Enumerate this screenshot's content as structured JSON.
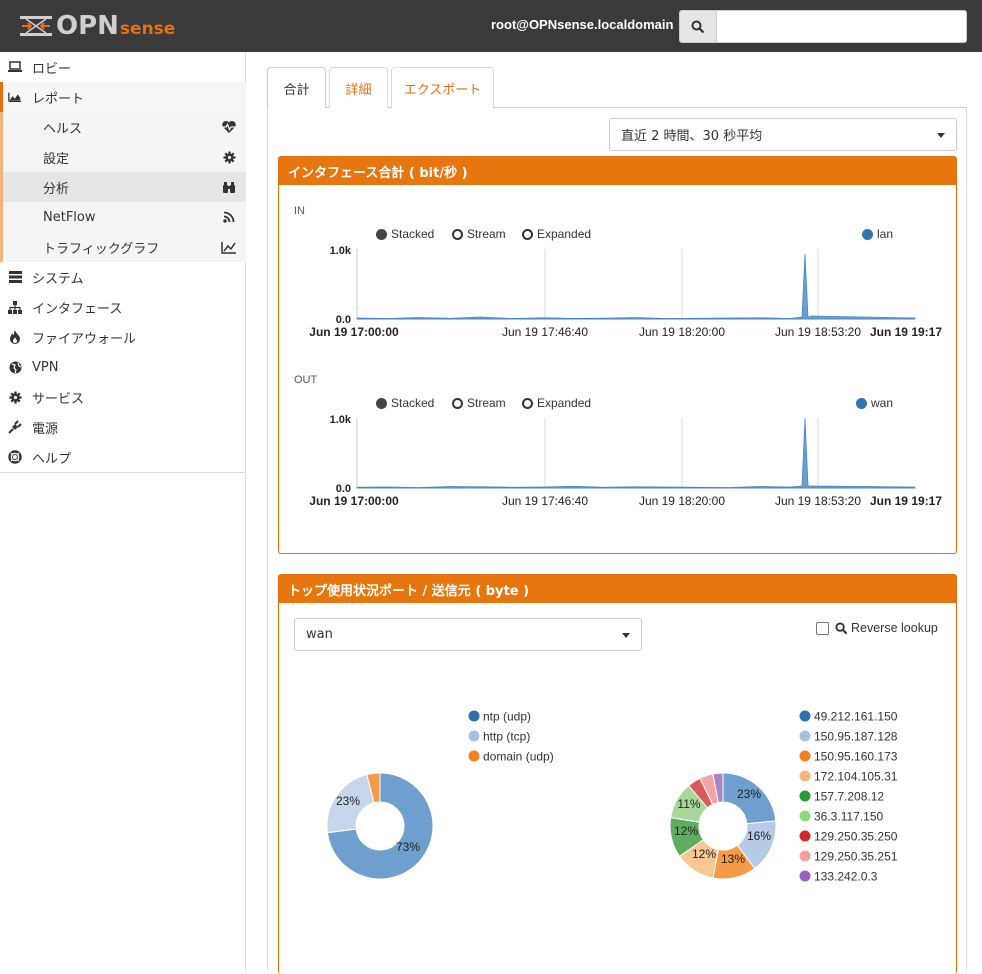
{
  "topbar": {
    "logo_opn": "OPN",
    "logo_sense": "sense",
    "user": "root@OPNsense.localdomain",
    "search_placeholder": ""
  },
  "sidebar": {
    "items": [
      {
        "label": "ロビー",
        "icon": "laptop-icon"
      },
      {
        "label": "レポート",
        "icon": "area-chart-icon"
      },
      {
        "label": "ヘルス",
        "icon": "heartbeat-icon",
        "sub": true
      },
      {
        "label": "設定",
        "icon": "gear-icon",
        "sub": true
      },
      {
        "label": "分析",
        "icon": "binoculars-icon",
        "sub": true,
        "selected": true
      },
      {
        "label": "NetFlow",
        "icon": "rss-icon",
        "sub": true
      },
      {
        "label": "トラフィックグラフ",
        "icon": "line-chart-icon",
        "sub": true
      },
      {
        "label": "システム",
        "icon": "server-icon"
      },
      {
        "label": "インタフェース",
        "icon": "sitemap-icon"
      },
      {
        "label": "ファイアウォール",
        "icon": "fire-icon"
      },
      {
        "label": "VPN",
        "icon": "globe-icon"
      },
      {
        "label": "サービス",
        "icon": "cog-icon"
      },
      {
        "label": "電源",
        "icon": "plug-icon"
      },
      {
        "label": "ヘルプ",
        "icon": "life-ring-icon"
      }
    ]
  },
  "tabs": [
    {
      "label": "合計",
      "active": true
    },
    {
      "label": "詳細",
      "active": false
    },
    {
      "label": "エクスポート",
      "active": false
    }
  ],
  "range_select": "直近 2 時間、30 秒平均",
  "interface_panel": {
    "title": "インタフェース合計 ( bit/秒 )",
    "in": {
      "label": "IN",
      "modes": [
        "Stacked",
        "Stream",
        "Expanded"
      ],
      "series": "lan"
    },
    "out": {
      "label": "OUT",
      "modes": [
        "Stacked",
        "Stream",
        "Expanded"
      ],
      "series": "wan"
    },
    "y_ticks": [
      "1.0k",
      "0.0"
    ],
    "x_ticks": [
      "Jun 19 17:00:00",
      "Jun 19 17:46:40",
      "Jun 19 18:20:00",
      "Jun 19 18:53:20",
      "Jun 19 19:17"
    ]
  },
  "chart_data": [
    {
      "type": "area",
      "title": "",
      "xlabel": "",
      "ylabel": "",
      "series": [
        {
          "name": "lan",
          "values": [
            20,
            10,
            30,
            15,
            40,
            10,
            25,
            12,
            18,
            30,
            10,
            15,
            20,
            25,
            10,
            1300,
            60,
            20
          ]
        }
      ],
      "x": [
        "17:00",
        "17:07",
        "17:14",
        "17:21",
        "17:28",
        "17:35",
        "17:42",
        "17:49",
        "17:56",
        "18:03",
        "18:10",
        "18:17",
        "18:24",
        "18:31",
        "18:38",
        "18:45",
        "18:52",
        "18:59"
      ],
      "ylim": [
        0,
        1400
      ]
    },
    {
      "type": "area",
      "title": "",
      "xlabel": "",
      "ylabel": "",
      "series": [
        {
          "name": "wan",
          "values": [
            15,
            20,
            10,
            30,
            25,
            15,
            20,
            35,
            15,
            25,
            20,
            15,
            10,
            30,
            20,
            1400,
            40,
            20
          ]
        }
      ],
      "x": [
        "17:00",
        "17:07",
        "17:14",
        "17:21",
        "17:28",
        "17:35",
        "17:42",
        "17:49",
        "17:56",
        "18:03",
        "18:10",
        "18:17",
        "18:24",
        "18:31",
        "18:38",
        "18:45",
        "18:52",
        "18:59"
      ],
      "ylim": [
        0,
        1400
      ]
    },
    {
      "type": "pie",
      "series": [
        {
          "name": "",
          "values": [
            73,
            23,
            4
          ]
        }
      ],
      "categories": [
        "ntp (udp)",
        "http (tcp)",
        "domain (udp)"
      ],
      "colors": [
        "#6f9fcf",
        "#c7d6ea",
        "#f59a4a"
      ]
    },
    {
      "type": "pie",
      "series": [
        {
          "name": "",
          "values": [
            23,
            16,
            13,
            12,
            12,
            11,
            4,
            4,
            3
          ]
        }
      ],
      "categories": [
        "49.212.161.150",
        "150.95.187.128",
        "150.95.160.173",
        "172.104.105.31",
        "157.7.208.12",
        "36.3.117.150",
        "129.250.35.250",
        "129.250.35.251",
        "133.242.0.3"
      ],
      "colors": [
        "#6f9fcf",
        "#b7cbe6",
        "#f79a45",
        "#f8c794",
        "#5fad5f",
        "#a9d79a",
        "#d95b5b",
        "#f3a5a5",
        "#a987c6"
      ]
    }
  ],
  "top_panel": {
    "title": "トップ使用状況ポート / 送信元 ( byte )",
    "select": "wan",
    "reverse_lookup": "Reverse lookup",
    "pie1_labels": [
      "23%",
      "73%"
    ],
    "pie2_labels": [
      "23%",
      "16%",
      "13%",
      "12%",
      "12%",
      "11%"
    ]
  },
  "colors": {
    "accent": "#e86f11",
    "series": "#3f7fbf"
  }
}
